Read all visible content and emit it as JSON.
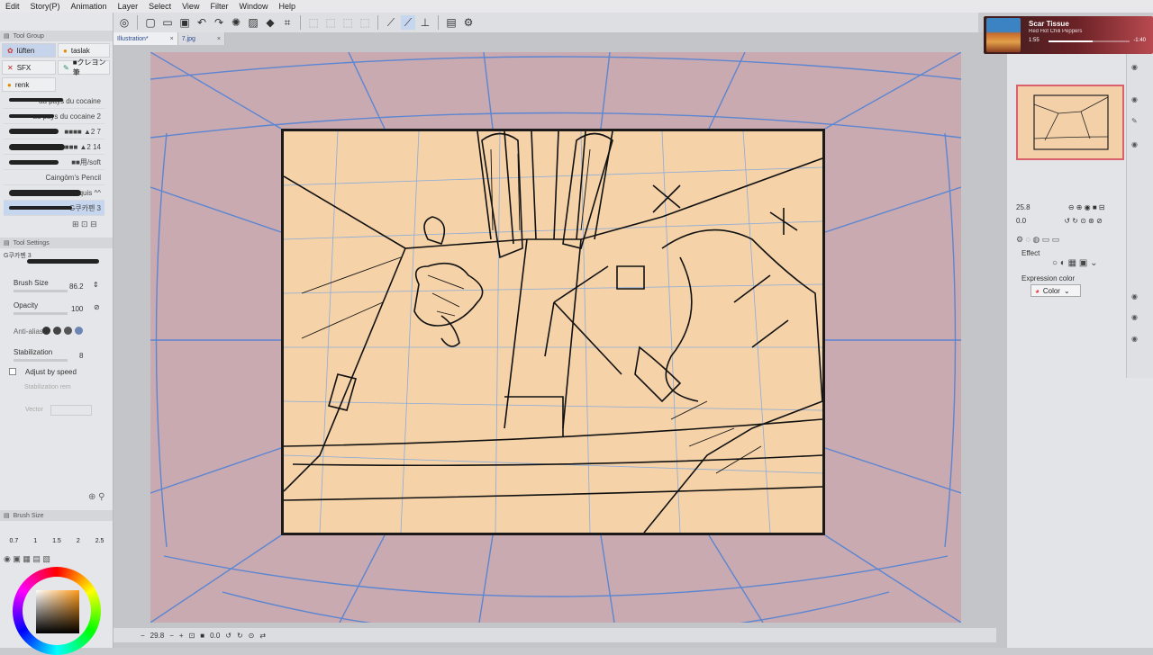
{
  "menu": [
    "Edit",
    "Story(P)",
    "Animation",
    "Layer",
    "Select",
    "View",
    "Filter",
    "Window",
    "Help"
  ],
  "tabs": [
    {
      "label": "Illustration*",
      "close": "×"
    },
    {
      "label": "7.jpg",
      "close": "×"
    }
  ],
  "tool_group": {
    "header": "Tool Group",
    "tools": [
      "lüften",
      "taslak",
      "SFX",
      "■クレヨン筆",
      "renk"
    ]
  },
  "brushes": [
    "au pays du cocaine",
    "au pays du cocaine 2",
    "■■■■ ▲2 7",
    "■■■■ ▲2 14",
    "■■用/soft",
    "Caingōm's Pencil",
    "Croquis ^^",
    "G쿠카펜 3"
  ],
  "tool_settings": {
    "header": "Tool Settings",
    "brush_name": "G쿠카펜 3",
    "brush_size_label": "Brush Size",
    "brush_size_value": "86.2",
    "opacity_label": "Opacity",
    "opacity_value": "100",
    "antialias_label": "Anti-alias",
    "stabilization_label": "Stabilization",
    "stabilization_value": "8",
    "adjust_by_speed": "Adjust by speed",
    "stabilization_note": "Stabilization rem",
    "vector_label": "Vector"
  },
  "brush_size_panel": {
    "header": "Brush Size",
    "presets": [
      "0.7",
      "1",
      "1.5",
      "2",
      "2.5"
    ]
  },
  "media": {
    "title": "Scar Tissue",
    "artist": "Red Hot Chili Peppers",
    "elapsed": "1:55",
    "remaining": "-1:40",
    "progress": 0.54
  },
  "navigator": {
    "zoom": "25.8",
    "rotation": "0.0"
  },
  "effect": {
    "label": "Effect",
    "expression_color_label": "Expression color",
    "color_value": "Color"
  },
  "bottombar": {
    "zoom": "29.8",
    "angle": "0.0"
  },
  "colors": {
    "paper": "#c8aab0",
    "art": "#f5d2a8",
    "perspective": "#4a7fd8",
    "selected": "#c6d6ee"
  }
}
